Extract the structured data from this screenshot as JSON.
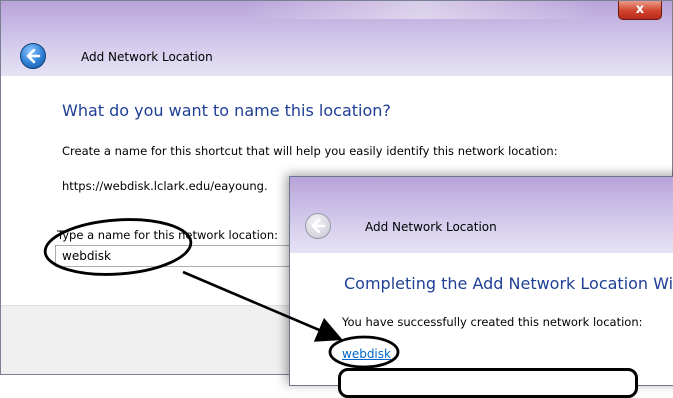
{
  "main_window": {
    "title": "Add Network Location",
    "close_glyph": "x",
    "heading": "What do you want to name this location?",
    "instruction": "Create a name for this shortcut that will help you easily identify this network location:",
    "address": "https://webdisk.lclark.edu/eayoung.",
    "field_label": "Type a name for this network location:",
    "name_value": "webdisk"
  },
  "completion_window": {
    "title": "Add Network Location",
    "heading": "Completing the Add Network Location Wiza",
    "message": "You have successfully created this network location:",
    "link_text": "webdisk"
  },
  "colors": {
    "heading": "#1e3f95",
    "link": "#0066cc",
    "title_glass": "#c9bde6"
  },
  "icons": {
    "back_active": "back-arrow-icon",
    "back_disabled": "back-arrow-icon-disabled",
    "close": "close-icon"
  }
}
